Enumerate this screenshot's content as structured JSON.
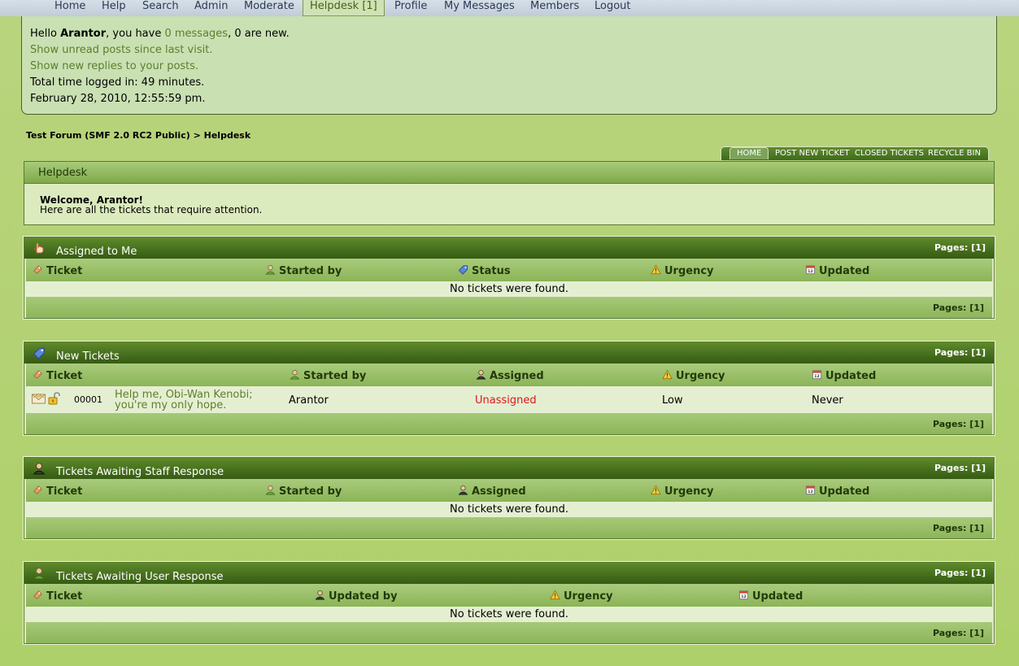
{
  "nav": {
    "home": "Home",
    "help": "Help",
    "search": "Search",
    "admin": "Admin",
    "moderate": "Moderate",
    "helpdesk": "Helpdesk [1]",
    "profile": "Profile",
    "messages": "My Messages",
    "members": "Members",
    "logout": "Logout"
  },
  "user": {
    "hello": "Hello ",
    "name": "Arantor",
    "have": ", you have ",
    "messages_link": "0 messages",
    "new_text": ", 0 are new.",
    "unread_link": "Show unread posts since last visit.",
    "replies_link": "Show new replies to your posts.",
    "time_logged": "Total time logged in: 49 minutes.",
    "date": "February 28, 2010, 12:55:59 pm."
  },
  "breadcrumb": {
    "forum": "Test Forum (SMF 2.0 RC2 Public)",
    "sep": " > ",
    "current": "Helpdesk"
  },
  "tabs": {
    "home": "HOME",
    "post_new": "POST NEW TICKET",
    "closed": "CLOSED TICKETS",
    "recycle": "RECYCLE BIN"
  },
  "welcome": {
    "title": "Helpdesk",
    "greeting": "Welcome, Arantor!",
    "text": "Here are all the tickets that require attention."
  },
  "common": {
    "pages": "Pages: [1]",
    "no_tickets": "No tickets were found."
  },
  "sections": {
    "assigned": {
      "title": "Assigned to Me",
      "cols": {
        "ticket": "Ticket",
        "started_by": "Started by",
        "status": "Status",
        "urgency": "Urgency",
        "updated": "Updated"
      }
    },
    "new": {
      "title": "New Tickets",
      "cols": {
        "ticket": "Ticket",
        "started_by": "Started by",
        "assigned": "Assigned",
        "urgency": "Urgency",
        "updated": "Updated"
      },
      "row": {
        "id": "00001",
        "subject_line1": "Help me, Obi-Wan Kenobi;",
        "subject_line2": "you're my only hope.",
        "started_by": "Arantor",
        "assigned": "Unassigned",
        "urgency": "Low",
        "updated": "Never"
      }
    },
    "staff": {
      "title": "Tickets Awaiting Staff Response",
      "cols": {
        "ticket": "Ticket",
        "started_by": "Started by",
        "assigned": "Assigned",
        "urgency": "Urgency",
        "updated": "Updated"
      }
    },
    "user": {
      "title": "Tickets Awaiting User Response",
      "cols": {
        "ticket": "Ticket",
        "updated_by": "Updated by",
        "urgency": "Urgency",
        "updated": "Updated"
      }
    }
  },
  "colors": {
    "link": "#5c7f2c",
    "unassigned": "#e0141e",
    "header_dark": "#355b12"
  }
}
